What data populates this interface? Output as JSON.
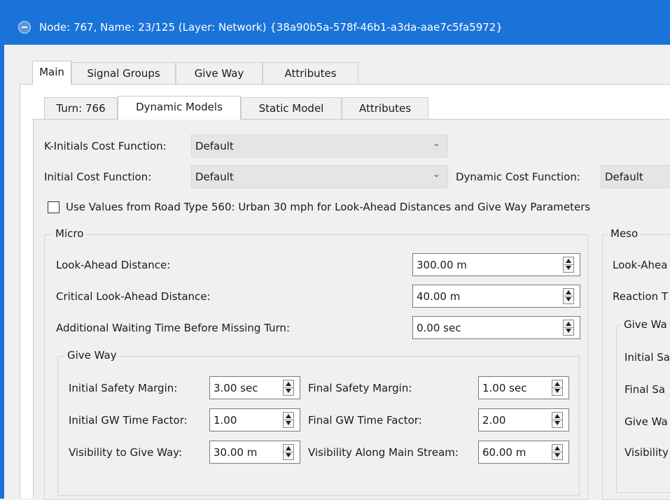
{
  "window": {
    "title": "Node: 767, Name: 23/125 (Layer: Network) {38a90b5a-578f-46b1-a3da-aae7c5fa5972}"
  },
  "main_tabs": [
    "Main",
    "Signal Groups",
    "Give Way",
    "Attributes"
  ],
  "sub_tabs": [
    "Turn: 766",
    "Dynamic Models",
    "Static Model",
    "Attributes"
  ],
  "fields": {
    "k_initials_label": "K-Initials Cost Function:",
    "k_initials_value": "Default",
    "initial_cost_label": "Initial Cost Function:",
    "initial_cost_value": "Default",
    "dynamic_cost_label": "Dynamic Cost Function:",
    "dynamic_cost_value": "Default",
    "use_values_label": "Use Values from Road Type 560: Urban 30 mph for Look-Ahead Distances and Give Way Parameters",
    "use_values_checked": false
  },
  "micro": {
    "title": "Micro",
    "look_ahead_label": "Look-Ahead Distance:",
    "look_ahead_value": "300.00 m",
    "critical_label": "Critical Look-Ahead Distance:",
    "critical_value": "40.00 m",
    "waiting_label": "Additional Waiting Time Before Missing Turn:",
    "waiting_value": "0.00 sec",
    "give_way": {
      "title": "Give Way",
      "initial_safety_label": "Initial Safety Margin:",
      "initial_safety_value": "3.00 sec",
      "final_safety_label": "Final Safety Margin:",
      "final_safety_value": "1.00 sec",
      "initial_gw_label": "Initial GW Time Factor:",
      "initial_gw_value": "1.00",
      "final_gw_label": "Final GW Time Factor:",
      "final_gw_value": "2.00",
      "visibility_gw_label": "Visibility to Give Way:",
      "visibility_gw_value": "30.00 m",
      "visibility_main_label": "Visibility Along Main Stream:",
      "visibility_main_value": "60.00 m"
    }
  },
  "meso": {
    "title": "Meso",
    "look_ahead_label": "Look-Ahea",
    "reaction_label": "Reaction T",
    "give_way": {
      "title": "Give Wa",
      "initial_label": "Initial Sa",
      "final_label": "Final Sa",
      "give_label": "Give Wa",
      "visibility_label": "Visibility"
    }
  }
}
